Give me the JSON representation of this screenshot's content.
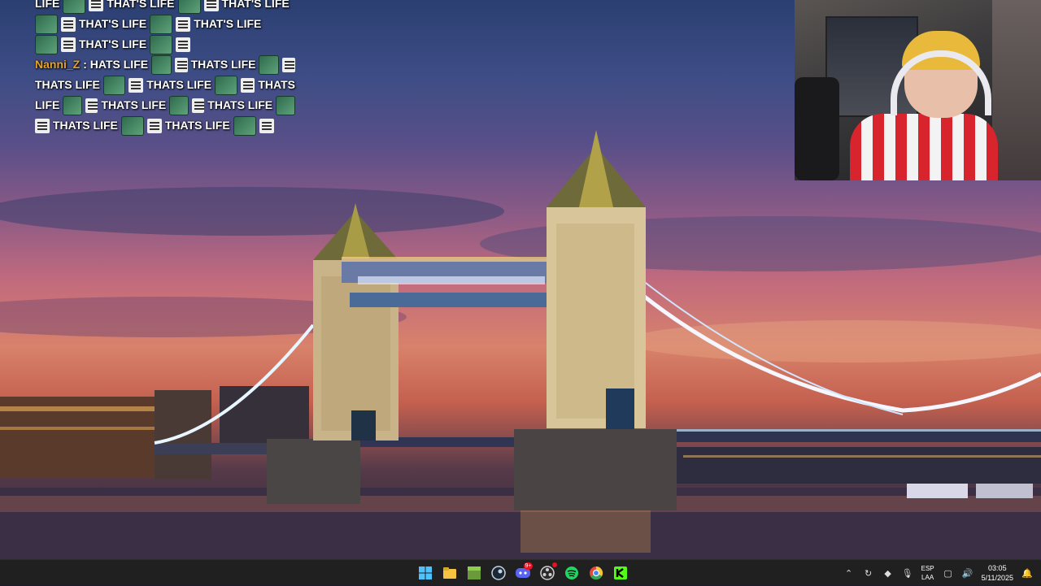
{
  "chat": {
    "lines": [
      {
        "segments": [
          {
            "t": "LIFE"
          },
          {
            "e": "a"
          },
          {
            "e": "b"
          },
          {
            "t": "THAT'S LIFE"
          },
          {
            "e": "a"
          },
          {
            "e": "b"
          },
          {
            "t": "THAT'S LIFE"
          }
        ]
      },
      {
        "segments": [
          {
            "e": "a"
          },
          {
            "e": "b"
          },
          {
            "t": "THAT'S LIFE"
          },
          {
            "e": "a"
          },
          {
            "e": "b"
          },
          {
            "t": "THAT'S LIFE"
          }
        ]
      },
      {
        "segments": [
          {
            "e": "a"
          },
          {
            "e": "b"
          },
          {
            "t": "THAT'S LIFE"
          },
          {
            "e": "a"
          },
          {
            "e": "b"
          }
        ]
      },
      {
        "segments": [
          {
            "u": "Nanni_Z"
          },
          {
            "t": ": HATS LIFE"
          },
          {
            "e": "a"
          },
          {
            "e": "b"
          },
          {
            "t": "THATS LIFE"
          },
          {
            "e": "a"
          },
          {
            "e": "b"
          }
        ]
      },
      {
        "segments": [
          {
            "t": "THATS LIFE"
          },
          {
            "e": "a"
          },
          {
            "e": "b"
          },
          {
            "t": "THATS LIFE"
          },
          {
            "e": "a"
          },
          {
            "e": "b"
          },
          {
            "t": "THATS"
          }
        ]
      },
      {
        "segments": [
          {
            "t": "LIFE"
          },
          {
            "e": "a"
          },
          {
            "e": "b"
          },
          {
            "t": "THATS LIFE"
          },
          {
            "e": "a"
          },
          {
            "e": "b"
          },
          {
            "t": "THATS LIFE"
          },
          {
            "e": "a"
          }
        ]
      },
      {
        "segments": [
          {
            "e": "b"
          },
          {
            "t": "THATS LIFE"
          },
          {
            "e": "a"
          },
          {
            "e": "b"
          },
          {
            "t": "THATS LIFE"
          },
          {
            "e": "a"
          },
          {
            "e": "b"
          }
        ]
      }
    ]
  },
  "taskbar": {
    "apps": [
      {
        "name": "windows-start-icon",
        "color": "#4cc2ff"
      },
      {
        "name": "file-explorer-icon",
        "color": "#f5c542"
      },
      {
        "name": "minecraft-icon",
        "color": "#6a9a3a"
      },
      {
        "name": "steam-icon",
        "color": "#c7d5e0"
      },
      {
        "name": "discord-icon",
        "color": "#5865f2",
        "badge": "9+"
      },
      {
        "name": "obs-icon",
        "color": "#d0d0d0",
        "dot": true
      },
      {
        "name": "spotify-icon",
        "color": "#1ed760"
      },
      {
        "name": "chrome-icon",
        "color": "#e5483a"
      },
      {
        "name": "kick-icon",
        "color": "#53fc18"
      }
    ],
    "tray": {
      "lang_top": "ESP",
      "lang_bottom": "LAA",
      "time": "03:05",
      "date": "5/11/2025"
    }
  }
}
